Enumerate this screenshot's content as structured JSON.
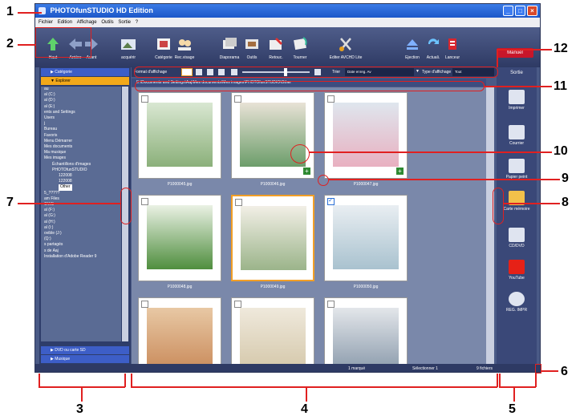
{
  "window": {
    "title": "PHOTOfunSTUDIO HD Edition"
  },
  "menu": [
    "Fichier",
    "Edition",
    "Affichage",
    "Outils",
    "Sortie",
    "?"
  ],
  "toolbar": {
    "buttons": [
      {
        "label": "Haut",
        "icon": "up-arrow-icon"
      },
      {
        "label": "Arrière",
        "icon": "back-arrow-icon"
      },
      {
        "label": "Avant",
        "icon": "forward-arrow-icon"
      },
      {
        "label": "acquérir",
        "icon": "acquire-icon"
      },
      {
        "label": "Catégorie",
        "icon": "category-icon"
      },
      {
        "label": "Rec.visage",
        "icon": "face-recognition-icon"
      },
      {
        "label": "Diaporama",
        "icon": "slideshow-icon"
      },
      {
        "label": "Outils",
        "icon": "tools-icon"
      },
      {
        "label": "Retouc.",
        "icon": "retouch-icon"
      },
      {
        "label": "Tourner",
        "icon": "rotate-icon"
      },
      {
        "label": "Editer AVCHD Lite",
        "icon": "edit-avchd-icon"
      },
      {
        "label": "Ejection",
        "icon": "eject-icon"
      },
      {
        "label": "Actuali.",
        "icon": "refresh-icon"
      },
      {
        "label": "Lanceur",
        "icon": "launcher-icon"
      }
    ],
    "manual_label": "Manuel"
  },
  "display_bar": {
    "format_label": "Format d'affichage",
    "sort_label": "Trier",
    "sort_value": "Date enreg. Av",
    "type_label": "Type d'affichage",
    "type_value": "Tout"
  },
  "path": "E:\\Documents and Settings\\Aaj\\Mes documents\\Mes images\\PHOTOfunSTUDIO\\Other",
  "left_panel": {
    "category_label": "Catégorie",
    "explorer_label": "Explorer",
    "tree": [
      "au",
      "al (C:)",
      "al (D:)",
      "al (E:)",
      "ents and Settings",
      "Users",
      "j",
      "Bureau",
      "Favoris",
      "Menu Démarrer",
      "Mes documents",
      "Ma musique",
      "Mes images",
      "Échantillons d'images",
      "PHOTOfunSTUDIO",
      "122008",
      "122008",
      "Other",
      "",
      "",
      "",
      "",
      "5_?????",
      "",
      "",
      "am Files",
      "OWS",
      "al (F:)",
      "al (G:)",
      "al (H:)",
      "al (I:)",
      "ovible (J:)",
      "(Q:)",
      "s partagés",
      "s de Aaj",
      "",
      "",
      "Installation d'Adobe Reader 9"
    ],
    "bottom": [
      "DVD ou carte SD",
      "Musique"
    ]
  },
  "thumbnails": [
    {
      "file": "P1000045.jpg",
      "selected": false,
      "plus": false,
      "checked": false
    },
    {
      "file": "P1000046.jpg",
      "selected": false,
      "plus": true,
      "checked": false
    },
    {
      "file": "P1000047.jpg",
      "selected": false,
      "plus": true,
      "checked": false
    },
    {
      "file": "P1000048.jpg",
      "selected": false,
      "plus": false,
      "checked": false
    },
    {
      "file": "P1000049.jpg",
      "selected": true,
      "plus": false,
      "checked": false
    },
    {
      "file": "P1000050.jpg",
      "selected": false,
      "plus": false,
      "checked": true
    },
    {
      "file": "",
      "selected": false,
      "plus": false,
      "checked": false
    },
    {
      "file": "",
      "selected": false,
      "plus": false,
      "checked": false
    },
    {
      "file": "",
      "selected": false,
      "plus": false,
      "checked": false
    }
  ],
  "right_panel": {
    "header": "Sortie",
    "items": [
      {
        "label": "Imprimer",
        "icon": "printer-icon"
      },
      {
        "label": "Courrier",
        "icon": "mail-icon"
      },
      {
        "label": "Papier peint",
        "icon": "wallpaper-icon"
      },
      {
        "label": "Carte mémoire",
        "icon": "memory-card-icon"
      },
      {
        "label": "CD/DVD",
        "icon": "cd-dvd-icon"
      },
      {
        "label": "YouTube",
        "icon": "youtube-icon"
      },
      {
        "label": "REG. IMPR",
        "icon": "print-register-icon"
      }
    ]
  },
  "status": {
    "marked": "1 marqué",
    "selected": "Sélectionner 1",
    "count": "9 fichiers"
  },
  "callouts": [
    "1",
    "2",
    "3",
    "4",
    "5",
    "6",
    "7",
    "8",
    "9",
    "10",
    "11",
    "12"
  ],
  "colors": {
    "accent_red": "#e02020",
    "titlebar": "#1c56c9",
    "explorer_tab": "#f2a81a"
  }
}
